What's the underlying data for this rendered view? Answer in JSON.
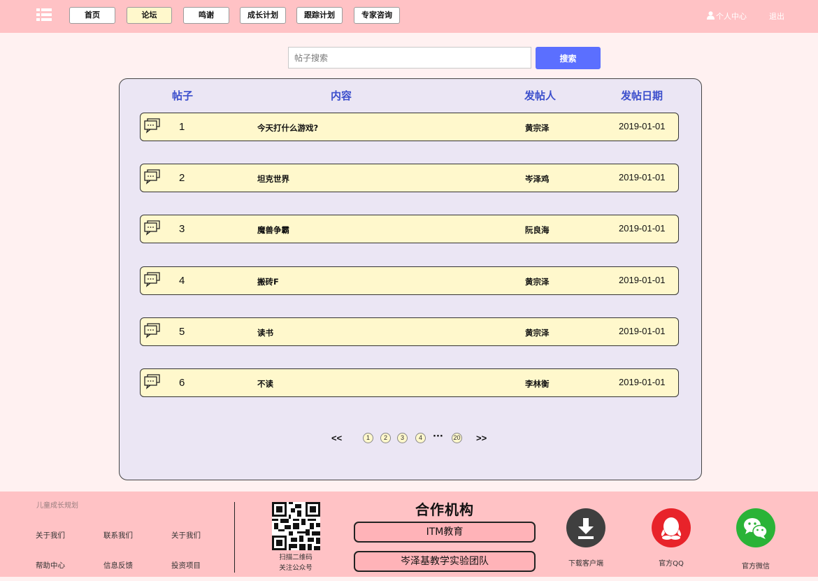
{
  "nav": {
    "items": [
      {
        "label": "首页",
        "active": false
      },
      {
        "label": "论坛",
        "active": true
      },
      {
        "label": "鸣谢",
        "active": false
      },
      {
        "label": "成长计划",
        "active": false
      },
      {
        "label": "跟踪计划",
        "active": false
      },
      {
        "label": "专家咨询",
        "active": false
      }
    ],
    "profile_label": "个人中心",
    "logout_label": "退出"
  },
  "search": {
    "placeholder": "帖子搜索",
    "button_label": "搜索"
  },
  "table": {
    "headers": {
      "post": "帖子",
      "content": "内容",
      "author": "发帖人",
      "date": "发帖日期"
    },
    "rows": [
      {
        "num": "1",
        "title": "今天打什么游戏?",
        "author": "黄宗泽",
        "date": "2019-01-01"
      },
      {
        "num": "2",
        "title": "坦克世界",
        "author": "岑泽鸡",
        "date": "2019-01-01"
      },
      {
        "num": "3",
        "title": "魔兽争霸",
        "author": "阮良海",
        "date": "2019-01-01"
      },
      {
        "num": "4",
        "title": "搬砖F",
        "author": "黄宗泽",
        "date": "2019-01-01"
      },
      {
        "num": "5",
        "title": "读书",
        "author": "黄宗泽",
        "date": "2019-01-01"
      },
      {
        "num": "6",
        "title": "不读",
        "author": "李林衡",
        "date": "2019-01-01"
      }
    ]
  },
  "pagination": {
    "prev": "<<",
    "next": ">>",
    "pages": [
      "1",
      "2",
      "3",
      "4",
      "20"
    ],
    "ellipsis": "···"
  },
  "footer": {
    "brand": "儿童成长规划",
    "links": [
      "关于我们",
      "联系我们",
      "关于我们",
      "帮助中心",
      "信息反馈",
      "投资项目"
    ],
    "qr_caption_1": "扫描二维码",
    "qr_caption_2": "关注公众号",
    "partners_title": "合作机构",
    "partners": [
      "ITM教育",
      "岑泽基教学实验团队"
    ],
    "download_label": "下载客户端",
    "qq_label": "官方QQ",
    "wechat_label": "官方微信"
  },
  "colors": {
    "topbar": "#ffc2c5",
    "page_bg": "#fff1f1",
    "panel_bg": "#ebe6f4",
    "row_bg": "#fff8cc",
    "accent_blue": "#5b6fff",
    "header_blue": "#3c4fcc",
    "qq_red": "#e8232a",
    "wechat_green": "#2ab337"
  }
}
